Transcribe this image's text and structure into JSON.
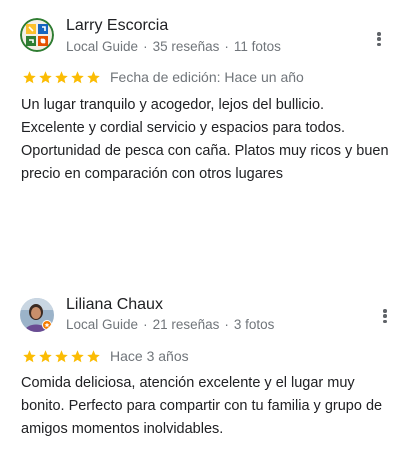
{
  "reviews": [
    {
      "name": "Larry Escorcia",
      "guide_label": "Local Guide",
      "reviews_count": "35 reseñas",
      "photos_count": "11 fotos",
      "stars": 5,
      "date": "Fecha de edición: Hace un año",
      "text": "Un lugar tranquilo y acogedor, lejos del bullicio. Excelente y cordial servicio y espacios para todos. Oportunidad de pesca con caña. Platos muy ricos y buen precio en comparación con otros lugares"
    },
    {
      "name": "Liliana Chaux",
      "guide_label": "Local Guide",
      "reviews_count": "21 reseñas",
      "photos_count": "3 fotos",
      "stars": 5,
      "date": "Hace 3 años",
      "text": "Comida deliciosa, atención excelente y el lugar muy bonito. Perfecto para compartir con tu familia y grupo de amigos momentos inolvidables."
    }
  ],
  "colors": {
    "star": "#fbbc04",
    "secondary_text": "#70757a",
    "primary_text": "#202124",
    "menu_dots": "#5f6368"
  },
  "icons": {
    "menu": "more-vert-icon",
    "star": "star-icon",
    "local_guide_badge": "local-guide-badge-icon"
  }
}
